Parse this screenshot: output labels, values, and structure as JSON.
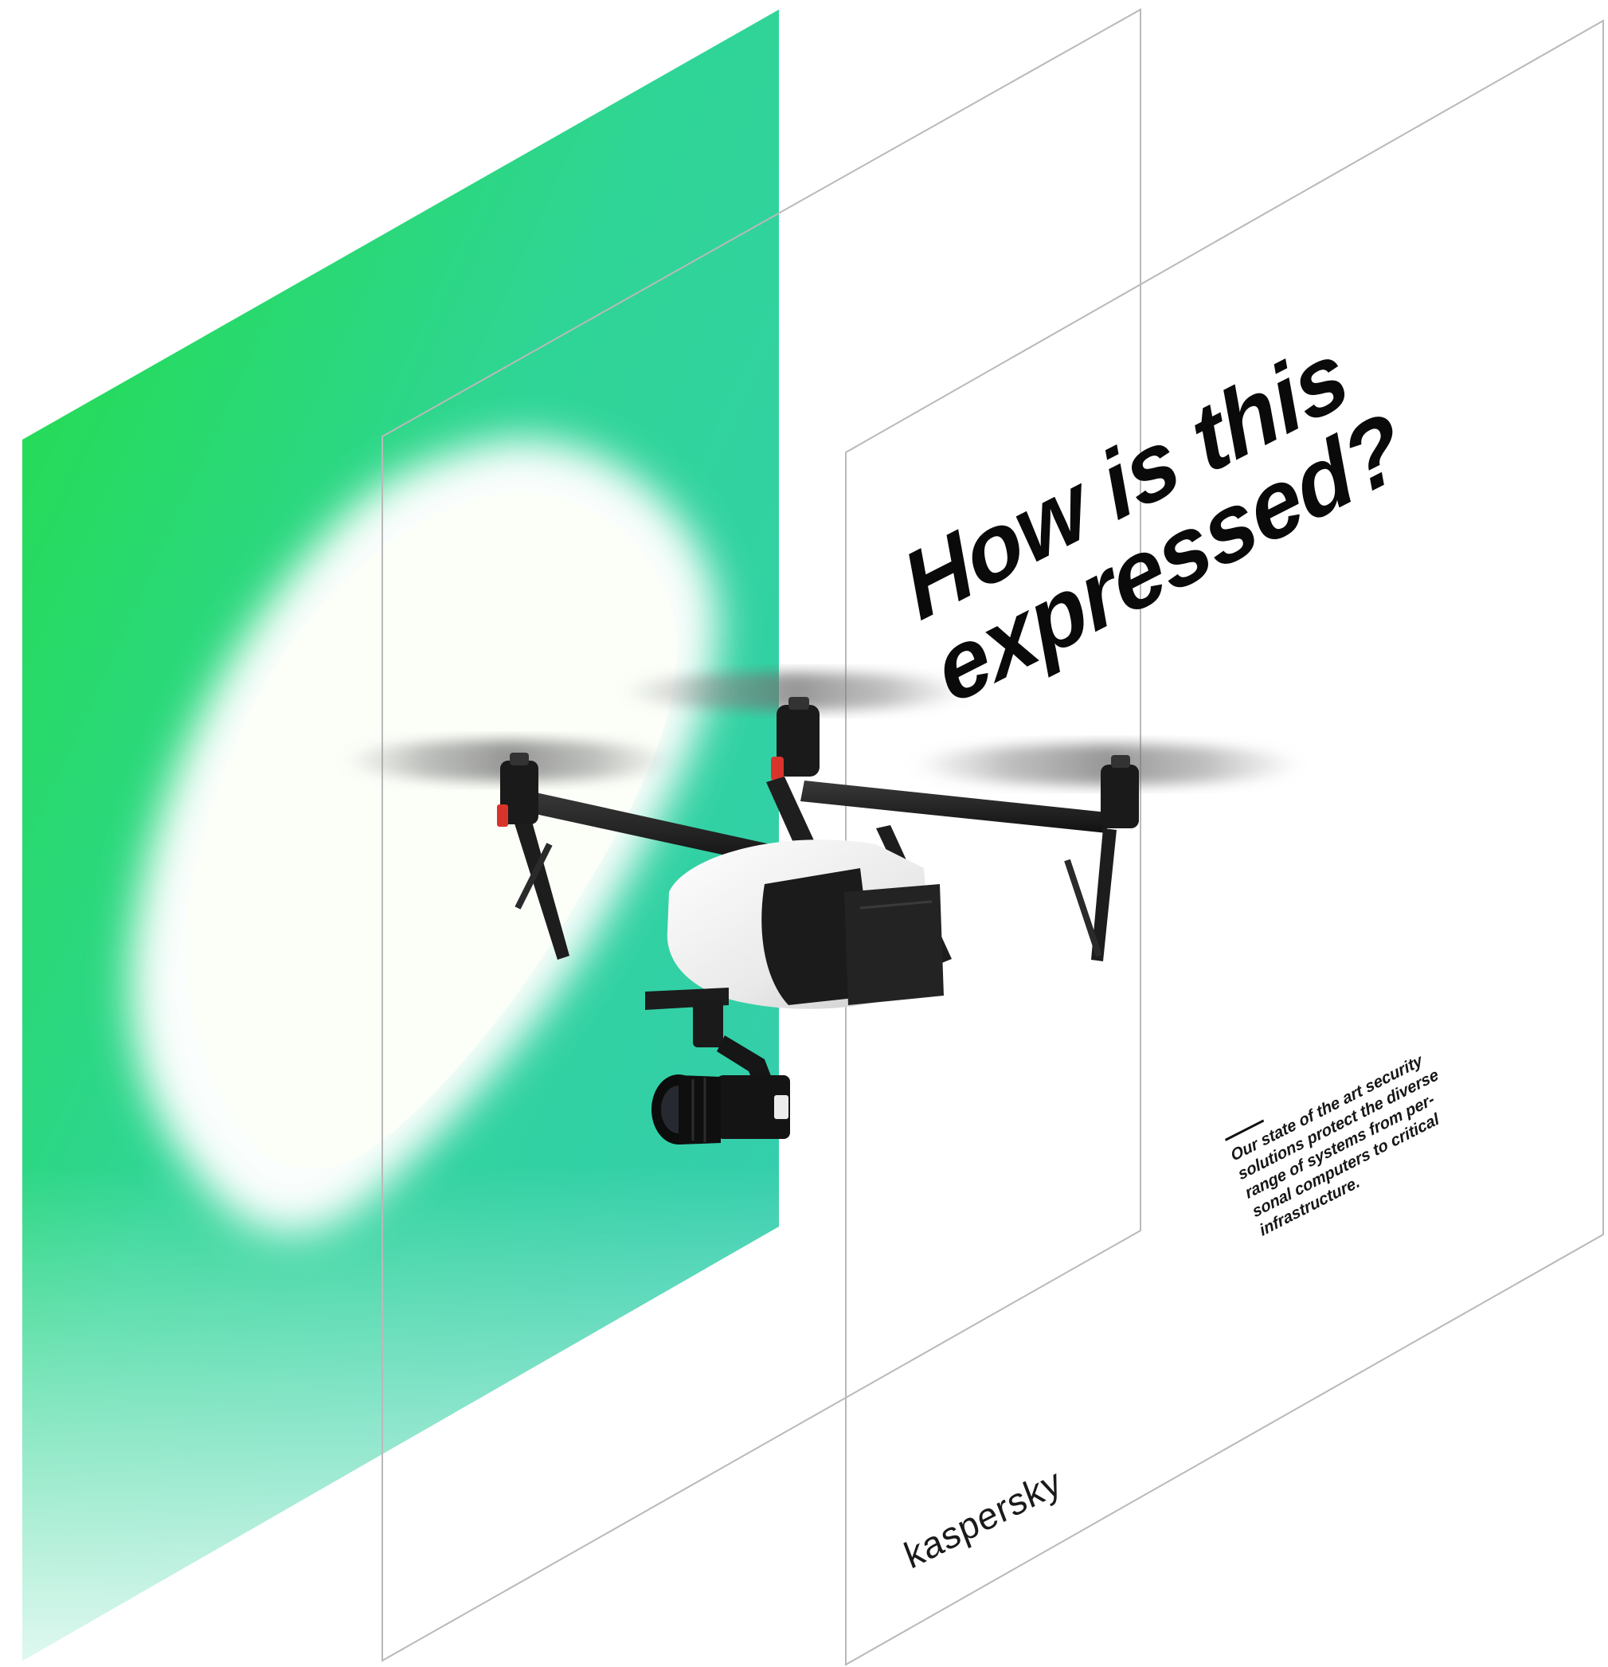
{
  "headline": {
    "line1": "How is this",
    "line2": "expressed?"
  },
  "body": {
    "line1": "Our state of the art security",
    "line2": "solutions protect the diverse",
    "line3": "range of systems from per-",
    "line4": "sonal computers to critical",
    "line5": "infrastructure."
  },
  "brand": {
    "logo_text": "kaspersky"
  },
  "colors": {
    "panel_green_bright": "#1EE33A",
    "panel_teal": "#33CCB0",
    "panel_outline": "#B8B8B8",
    "text_dark": "#0A0A0A",
    "drone_body": "#F2F2F2",
    "drone_dark": "#1C1C1C",
    "drone_accent_red": "#D9342B"
  },
  "illustration": {
    "subject": "quadcopter-drone-with-camera",
    "icon": "drone-icon"
  }
}
